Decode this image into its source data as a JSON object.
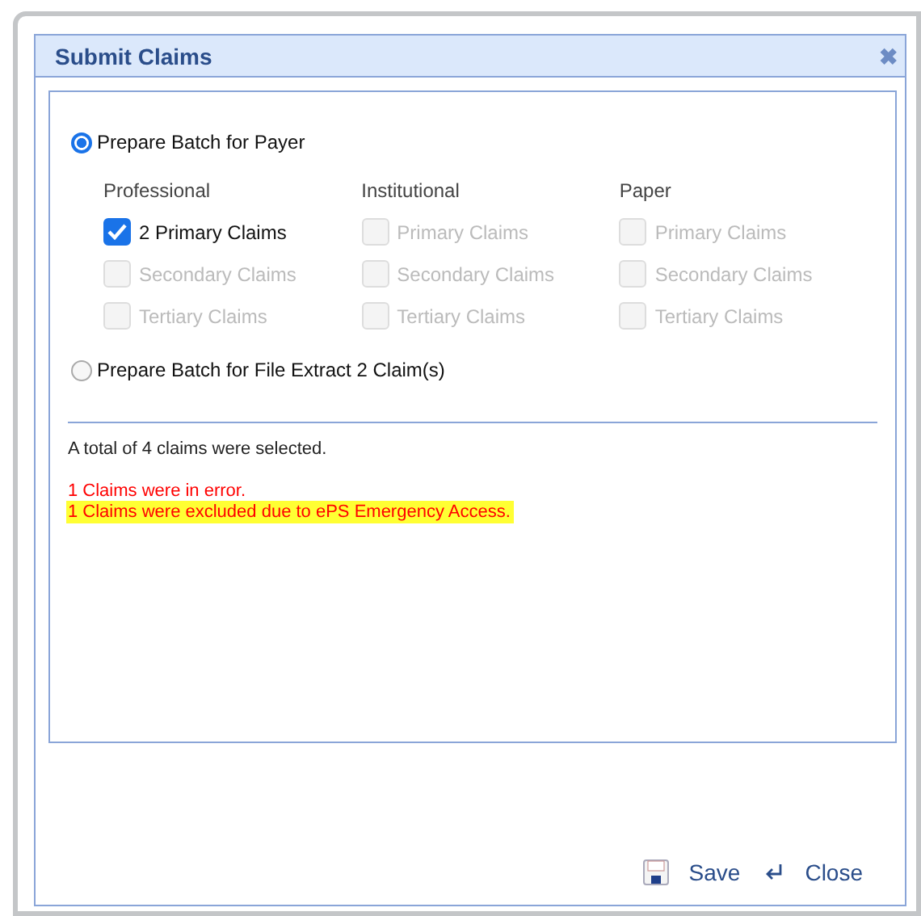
{
  "dialog": {
    "title": "Submit Claims",
    "close_icon": "✖"
  },
  "options": [
    {
      "label": "Prepare Batch for Payer",
      "selected": true,
      "kind": "batch"
    },
    {
      "label": "Prepare Batch for File Extract 2 Claim(s)",
      "selected": false,
      "kind": "plain"
    }
  ],
  "claim_groups": [
    {
      "header": "Professional",
      "items": [
        {
          "label": "2 Primary Claims",
          "checked": true,
          "disabled": false
        },
        {
          "label": "Secondary Claims",
          "checked": false,
          "disabled": true
        },
        {
          "label": "Tertiary Claims",
          "checked": false,
          "disabled": true
        }
      ]
    },
    {
      "header": "Institutional",
      "items": [
        {
          "label": "Primary Claims",
          "checked": false,
          "disabled": true
        },
        {
          "label": "Secondary Claims",
          "checked": false,
          "disabled": true
        },
        {
          "label": "Tertiary Claims",
          "checked": false,
          "disabled": true
        }
      ]
    },
    {
      "header": "Paper",
      "items": [
        {
          "label": "Primary Claims",
          "checked": false,
          "disabled": true
        },
        {
          "label": "Secondary Claims",
          "checked": false,
          "disabled": true
        },
        {
          "label": "Tertiary Claims",
          "checked": false,
          "disabled": true
        }
      ]
    }
  ],
  "messages": [
    {
      "text": "A total of 4 claims were selected.",
      "kind": "info"
    },
    {
      "text": "1 Claims were in error.",
      "kind": "error"
    },
    {
      "text": "1 Claims were excluded due to ePS Emergency Access.",
      "kind": "highlight"
    }
  ],
  "buttons": [
    {
      "label": "Save",
      "kind": "save"
    },
    {
      "label": "Close",
      "kind": "close"
    }
  ]
}
